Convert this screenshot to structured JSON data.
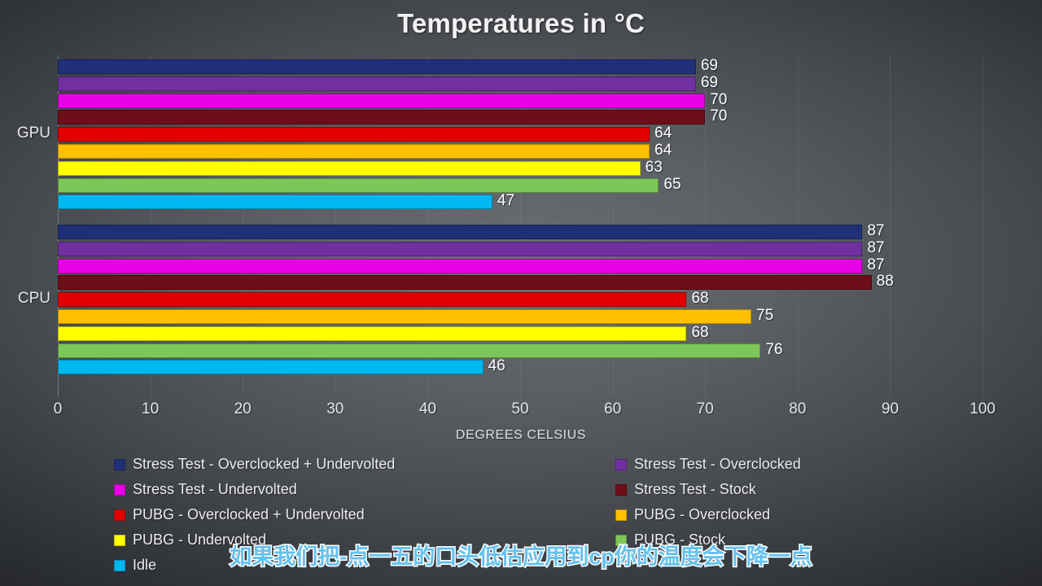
{
  "chart_data": {
    "type": "bar",
    "orientation": "horizontal",
    "title": "Temperatures in °C",
    "xlabel": "DEGREES CELSIUS",
    "ylabel": "",
    "xlim": [
      0,
      100
    ],
    "xticks": [
      0,
      10,
      20,
      30,
      40,
      50,
      60,
      70,
      80,
      90,
      100
    ],
    "grid": true,
    "legend_position": "bottom",
    "categories": [
      "GPU",
      "CPU"
    ],
    "series": [
      {
        "name": "Stress Test - Overclocked + Undervolted",
        "color": "#1F3078",
        "values": [
          69,
          87
        ]
      },
      {
        "name": "Stress Test - Overclocked",
        "color": "#7030A0",
        "values": [
          69,
          87
        ]
      },
      {
        "name": "Stress Test - Undervolted",
        "color": "#E800E8",
        "values": [
          70,
          87
        ]
      },
      {
        "name": "Stress Test - Stock",
        "color": "#6E0E18",
        "values": [
          70,
          88
        ]
      },
      {
        "name": "PUBG - Overclocked + Undervolted",
        "color": "#E00000",
        "values": [
          64,
          68
        ]
      },
      {
        "name": "PUBG - Overclocked",
        "color": "#FFC000",
        "values": [
          64,
          75
        ]
      },
      {
        "name": "PUBG - Undervolted",
        "color": "#FFFF00",
        "values": [
          63,
          68
        ]
      },
      {
        "name": "PUBG - Stock",
        "color": "#7DC65A",
        "values": [
          65,
          76
        ]
      },
      {
        "name": "Idle",
        "color": "#00B8F0",
        "values": [
          47,
          46
        ]
      }
    ]
  },
  "legend": {
    "items": [
      {
        "label": "Stress Test - Overclocked + Undervolted",
        "color": "#1F3078"
      },
      {
        "label": "Stress Test - Overclocked",
        "color": "#7030A0"
      },
      {
        "label": "Stress Test - Undervolted",
        "color": "#E800E8"
      },
      {
        "label": "Stress Test - Stock",
        "color": "#6E0E18"
      },
      {
        "label": "PUBG - Overclocked + Undervolted",
        "color": "#E00000"
      },
      {
        "label": "PUBG - Overclocked",
        "color": "#FFC000"
      },
      {
        "label": "PUBG - Undervolted",
        "color": "#FFFF00"
      },
      {
        "label": "PUBG - Stock",
        "color": "#7DC65A"
      },
      {
        "label": "Idle",
        "color": "#00B8F0"
      }
    ]
  },
  "subtitle_overlay": {
    "text": "如果我们把-点一五的口头低估应用到cp你的温度会下降一点",
    "color": "#66C2EF",
    "outline": "#FFFFFF"
  }
}
